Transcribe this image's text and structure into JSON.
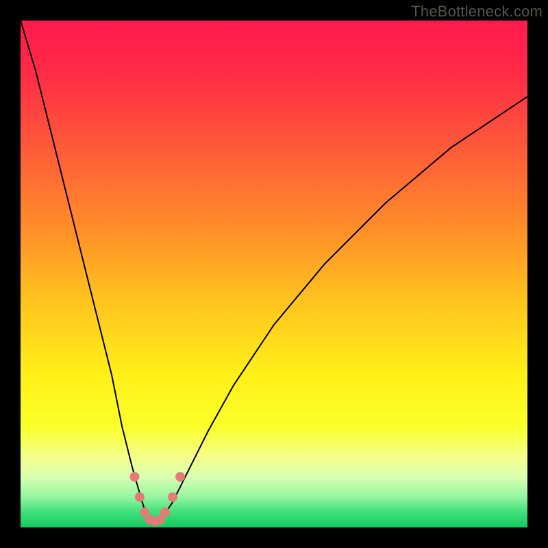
{
  "watermark": "TheBottleneck.com",
  "chart_data": {
    "type": "line",
    "title": "",
    "xlabel": "",
    "ylabel": "",
    "xlim": [
      0,
      100
    ],
    "ylim": [
      0,
      100
    ],
    "grid": false,
    "legend": false,
    "background": {
      "type": "vertical-gradient",
      "stops": [
        {
          "pos": 0.0,
          "color": "#ff1a4e"
        },
        {
          "pos": 0.1,
          "color": "#ff2a47"
        },
        {
          "pos": 0.25,
          "color": "#ff5a38"
        },
        {
          "pos": 0.4,
          "color": "#ff8a2a"
        },
        {
          "pos": 0.55,
          "color": "#ffc21e"
        },
        {
          "pos": 0.7,
          "color": "#fff018"
        },
        {
          "pos": 0.8,
          "color": "#fbff2a"
        },
        {
          "pos": 0.86,
          "color": "#f4ff88"
        },
        {
          "pos": 0.9,
          "color": "#d9ffb0"
        },
        {
          "pos": 0.94,
          "color": "#95f5a0"
        },
        {
          "pos": 0.97,
          "color": "#3fe07a"
        },
        {
          "pos": 1.0,
          "color": "#14c95e"
        }
      ]
    },
    "series": [
      {
        "name": "bottleneck-curve",
        "color": "#000000",
        "x": [
          0,
          3,
          6,
          9,
          12,
          15,
          18,
          20,
          22,
          24,
          25,
          26,
          27,
          28,
          30,
          33,
          37,
          42,
          50,
          60,
          72,
          85,
          100
        ],
        "values": [
          100,
          90,
          78,
          66,
          54,
          42,
          30,
          20,
          12,
          5,
          2,
          1,
          1,
          2,
          5,
          11,
          19,
          28,
          40,
          52,
          64,
          75,
          85
        ]
      }
    ],
    "markers": {
      "name": "highlight-dots",
      "color": "#e57b78",
      "points": [
        {
          "x": 22.5,
          "y": 10
        },
        {
          "x": 23.5,
          "y": 6
        },
        {
          "x": 24.5,
          "y": 3
        },
        {
          "x": 25.5,
          "y": 1.5
        },
        {
          "x": 26.5,
          "y": 1.2
        },
        {
          "x": 27.5,
          "y": 1.5
        },
        {
          "x": 28.5,
          "y": 3
        },
        {
          "x": 30.0,
          "y": 6
        },
        {
          "x": 31.5,
          "y": 10
        }
      ]
    }
  }
}
